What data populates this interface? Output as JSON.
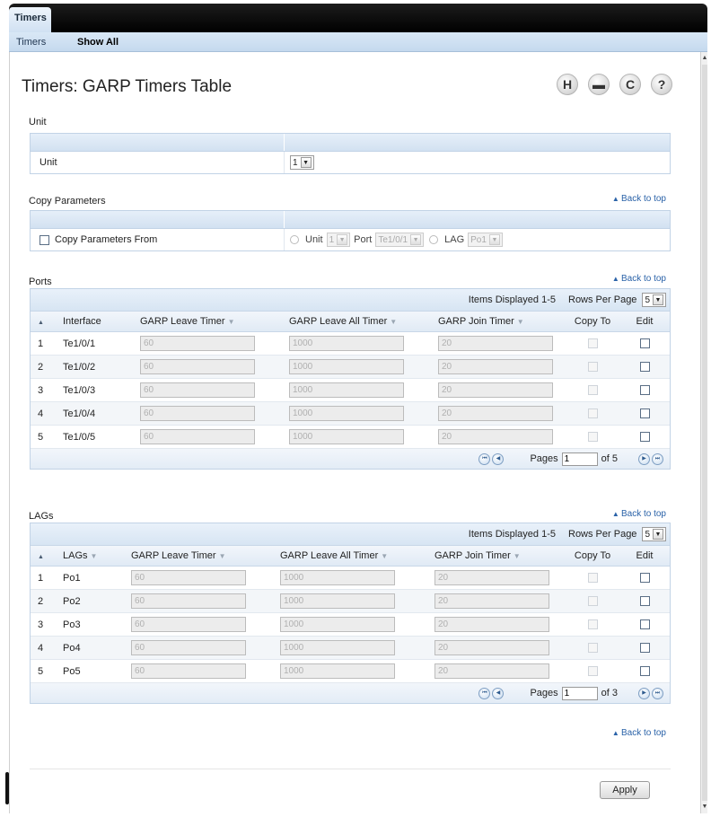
{
  "tabs": {
    "active": "Timers"
  },
  "subtabs": [
    {
      "label": "Timers"
    },
    {
      "label": "Show All"
    }
  ],
  "page_title": "Timers: GARP Timers Table",
  "toolbar_icons": [
    {
      "icon": "save-icon",
      "glyph": "H"
    },
    {
      "icon": "print-icon",
      "glyph": "▬"
    },
    {
      "icon": "refresh-icon",
      "glyph": "C"
    },
    {
      "icon": "help-icon",
      "glyph": "?"
    }
  ],
  "back_to_top": "Back to top",
  "unit_section": {
    "title": "Unit",
    "label": "Unit",
    "value": "1"
  },
  "copy_section": {
    "title": "Copy Parameters",
    "checkbox_label": "Copy Parameters From",
    "unit_label": "Unit",
    "unit_value": "1",
    "port_label": "Port",
    "port_value": "Te1/0/1",
    "lag_label": "LAG",
    "lag_value": "Po1"
  },
  "ports": {
    "title": "Ports",
    "items_displayed": "Items Displayed 1-5",
    "rows_per_page_label": "Rows Per Page",
    "rows_per_page": "5",
    "columns": {
      "interface": "Interface",
      "leave": "GARP Leave Timer",
      "leave_all": "GARP Leave All Timer",
      "join": "GARP Join Timer",
      "copy_to": "Copy To",
      "edit": "Edit"
    },
    "rows": [
      {
        "n": "1",
        "name": "Te1/0/1",
        "leave": "60",
        "leave_all": "1000",
        "join": "20"
      },
      {
        "n": "2",
        "name": "Te1/0/2",
        "leave": "60",
        "leave_all": "1000",
        "join": "20"
      },
      {
        "n": "3",
        "name": "Te1/0/3",
        "leave": "60",
        "leave_all": "1000",
        "join": "20"
      },
      {
        "n": "4",
        "name": "Te1/0/4",
        "leave": "60",
        "leave_all": "1000",
        "join": "20"
      },
      {
        "n": "5",
        "name": "Te1/0/5",
        "leave": "60",
        "leave_all": "1000",
        "join": "20"
      }
    ],
    "pages_label": "Pages",
    "page": "1",
    "of": "of 5"
  },
  "lags": {
    "title": "LAGs",
    "items_displayed": "Items Displayed 1-5",
    "rows_per_page_label": "Rows Per Page",
    "rows_per_page": "5",
    "columns": {
      "interface": "LAGs",
      "leave": "GARP Leave Timer",
      "leave_all": "GARP Leave All Timer",
      "join": "GARP Join Timer",
      "copy_to": "Copy To",
      "edit": "Edit"
    },
    "rows": [
      {
        "n": "1",
        "name": "Po1",
        "leave": "60",
        "leave_all": "1000",
        "join": "20"
      },
      {
        "n": "2",
        "name": "Po2",
        "leave": "60",
        "leave_all": "1000",
        "join": "20"
      },
      {
        "n": "3",
        "name": "Po3",
        "leave": "60",
        "leave_all": "1000",
        "join": "20"
      },
      {
        "n": "4",
        "name": "Po4",
        "leave": "60",
        "leave_all": "1000",
        "join": "20"
      },
      {
        "n": "5",
        "name": "Po5",
        "leave": "60",
        "leave_all": "1000",
        "join": "20"
      }
    ],
    "pages_label": "Pages",
    "page": "1",
    "of": "of 3"
  },
  "apply_label": "Apply"
}
